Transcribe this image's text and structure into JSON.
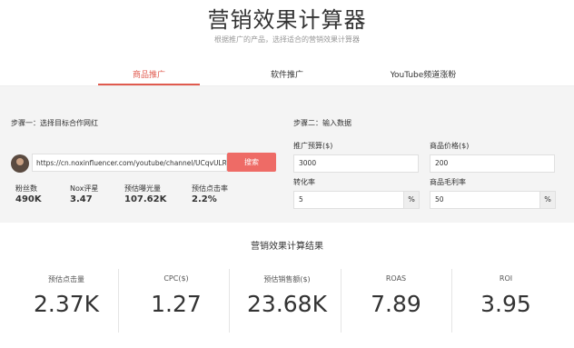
{
  "header": {
    "title": "营销效果计算器",
    "subtitle": "根据推广的产品，选择适合的营销效果计算器"
  },
  "tabs": [
    {
      "label": "商品推广",
      "active": true
    },
    {
      "label": "软件推广",
      "active": false
    },
    {
      "label": "YouTube频道涨粉",
      "active": false
    }
  ],
  "step1": {
    "title": "步骤一：选择目标合作网红",
    "url_value": "https://cn.noxinfluencer.com/youtube/channel/UCqvULRRboZe",
    "search_label": "搜索",
    "stats": [
      {
        "label": "粉丝数",
        "value": "490K"
      },
      {
        "label": "Nox评星",
        "value": "3.47"
      },
      {
        "label": "预估曝光量",
        "value": "107.62K"
      },
      {
        "label": "预估点击率",
        "value": "2.2%"
      }
    ]
  },
  "step2": {
    "title": "步骤二：输入数据",
    "budget_label": "推广预算($)",
    "budget_value": "3000",
    "price_label": "商品价格($)",
    "price_value": "200",
    "conversion_label": "转化率",
    "conversion_value": "5",
    "conversion_suffix": "%",
    "margin_label": "商品毛利率",
    "margin_value": "50",
    "margin_suffix": "%"
  },
  "results": {
    "title": "营销效果计算结果",
    "metrics": [
      {
        "label": "预估点击量",
        "value": "2.37K"
      },
      {
        "label": "CPC($)",
        "value": "1.27"
      },
      {
        "label": "预估销售额($)",
        "value": "23.68K"
      },
      {
        "label": "ROAS",
        "value": "7.89"
      },
      {
        "label": "ROI",
        "value": "3.95"
      }
    ]
  },
  "colors": {
    "accent": "#e05a4e",
    "button": "#ee6b66",
    "panel_bg": "#f4f4f4"
  }
}
